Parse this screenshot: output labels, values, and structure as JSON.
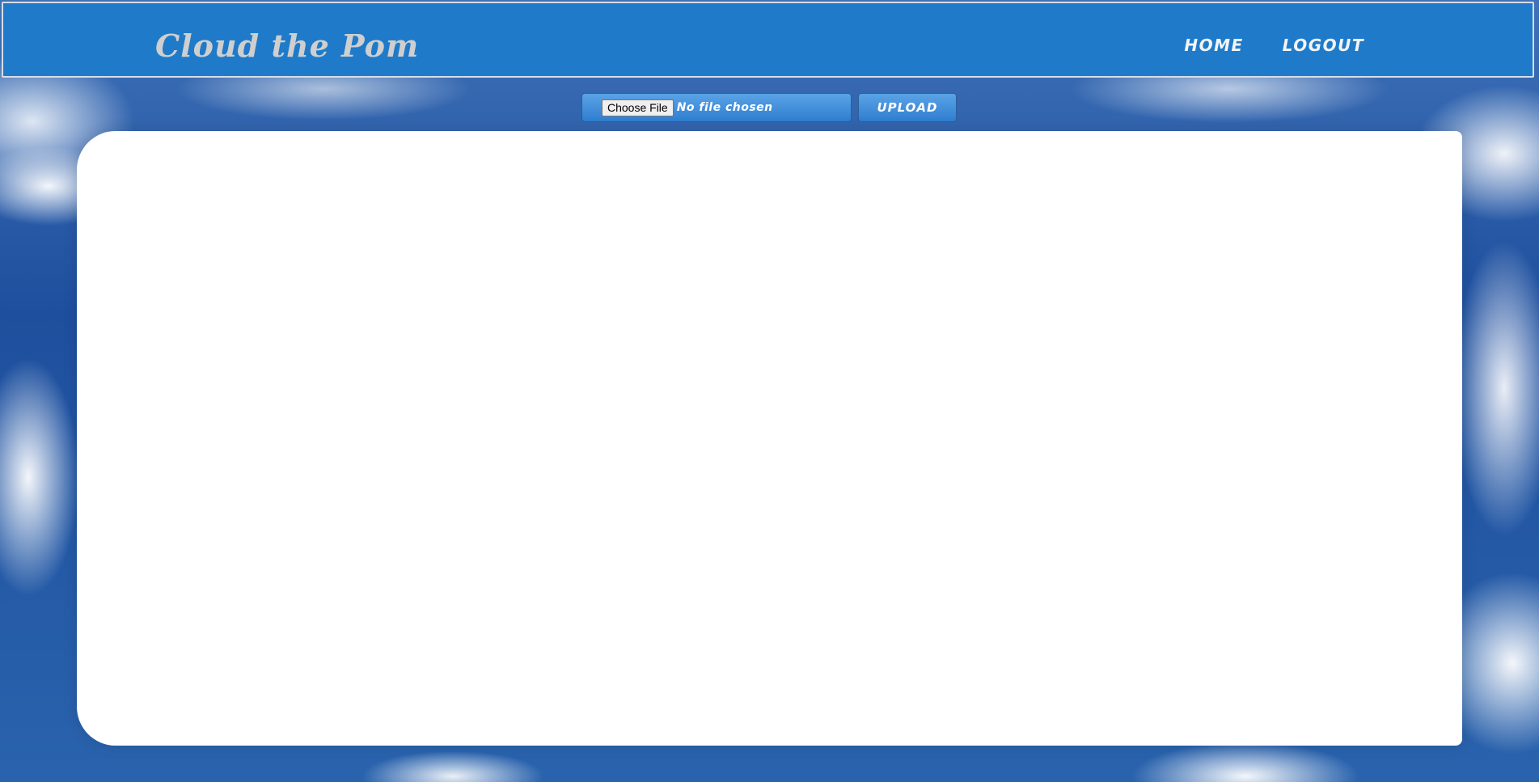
{
  "header": {
    "site_title": "Cloud the Pom",
    "nav": [
      {
        "label": "HOME"
      },
      {
        "label": "LOGOUT"
      }
    ]
  },
  "upload": {
    "choose_file_label": "Choose File",
    "file_status": "No file chosen",
    "upload_label": "UPLOAD"
  },
  "colors": {
    "header_background": "#1f7bc9",
    "button_gradient_top": "#5aa3e6",
    "button_gradient_bottom": "#2f7ed0",
    "panel_background": "#ffffff"
  }
}
